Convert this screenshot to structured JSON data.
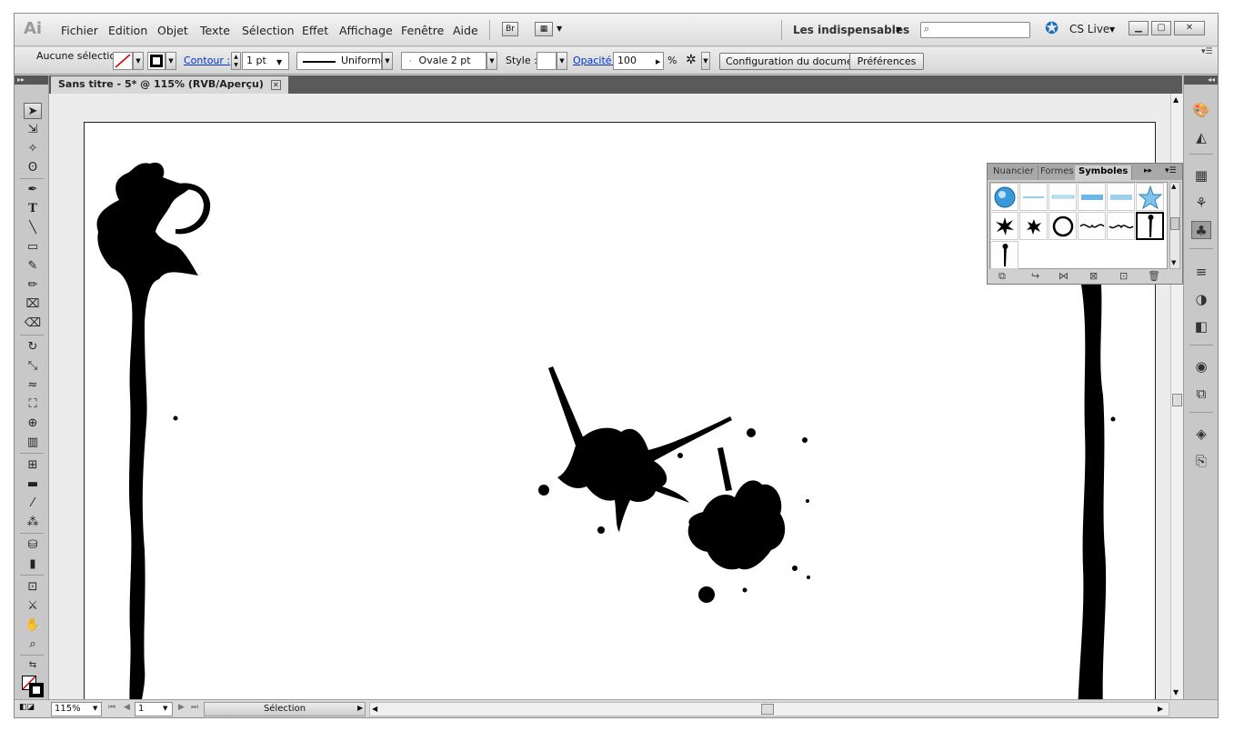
{
  "app": {
    "logo": "Ai"
  },
  "menu": [
    "Fichier",
    "Edition",
    "Objet",
    "Texte",
    "Sélection",
    "Effet",
    "Affichage",
    "Fenêtre",
    "Aide"
  ],
  "menubar_extra": {
    "bridge": "Br",
    "workspace": "Les indispensables",
    "cslive": "CS Live"
  },
  "control": {
    "selection_label": "Aucune sélection",
    "contour_label": "Contour :",
    "stroke_weight": "1 pt",
    "stroke_profile": "Uniforme",
    "brush": "Ovale 2 pt",
    "style_label": "Style :",
    "opacity_label": "Opacité :",
    "opacity_value": "100",
    "percent": "%",
    "doc_setup": "Configuration du document",
    "preferences": "Préférences"
  },
  "document": {
    "tab_title": "Sans titre - 5* @ 115% (RVB/Aperçu)"
  },
  "symbols_panel": {
    "tabs": [
      "Nuancier",
      "Formes",
      "Symboles"
    ],
    "active_tab": "Symboles"
  },
  "status": {
    "zoom": "115%",
    "page": "1",
    "tool": "Sélection"
  },
  "colors": {
    "dark_chrome": "#5a5a5a",
    "link": "#0033cc",
    "selected_symbol_border": "#000000"
  },
  "icons": {
    "window_minimize": "minimize-icon",
    "window_maximize": "maximize-icon",
    "window_close": "close-icon"
  }
}
